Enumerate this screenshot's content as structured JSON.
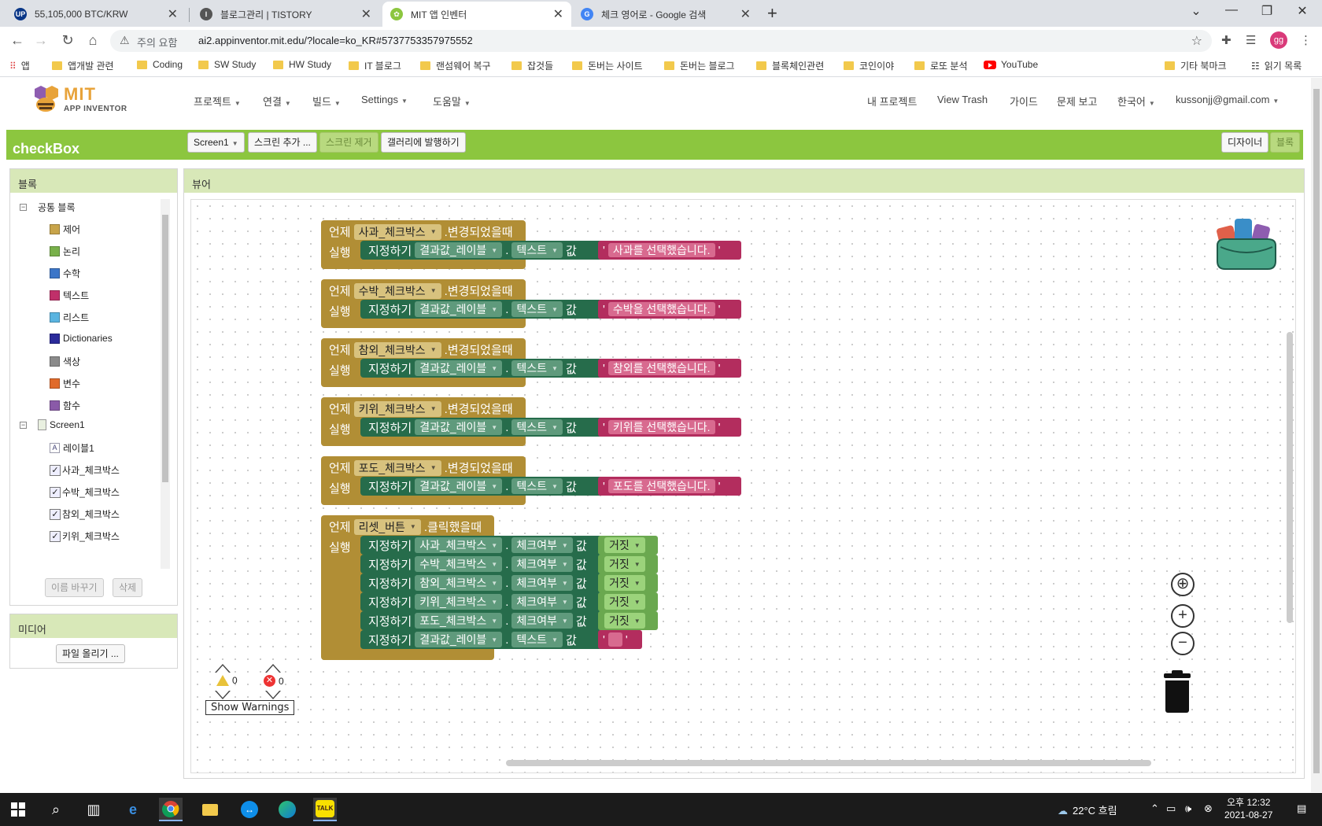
{
  "browser": {
    "tabs": [
      {
        "title": "55,105,000 BTC/KRW",
        "icon": "upbit-icon",
        "color": "#093687",
        "badge": "UP"
      },
      {
        "title": "블로그관리 | TISTORY",
        "icon": "tistory-icon",
        "color": "#333333",
        "badge": "⁝"
      },
      {
        "title": "MIT 앱 인벤터",
        "icon": "mit-app-inventor-icon",
        "color": "#8cc63f",
        "badge": "✿"
      },
      {
        "title": "체크 영어로 - Google 검색",
        "icon": "google-icon",
        "color": "#4285f4",
        "badge": "G"
      }
    ],
    "new_tab": "+",
    "security": "주의 요함",
    "url": "ai2.appinventor.mit.edu/?locale=ko_KR#5737753357975552",
    "profile_initials": "gg",
    "bookmarks": [
      "앱",
      "앱개발 관련",
      "Coding",
      "SW Study",
      "HW Study",
      "IT 블로그",
      "랜섬웨어 복구",
      "잡것들",
      "돈버는 사이트",
      "돈버는 블로그",
      "블록체인관련",
      "코인이야",
      "로또 분석",
      "YouTube"
    ],
    "bookmarks_right": [
      "기타 북마크",
      "읽기 목록"
    ]
  },
  "app_header": {
    "logo_mit": "MIT",
    "logo_sub": "APP INVENTOR",
    "menus": [
      "프로젝트",
      "연결",
      "빌드",
      "Settings",
      "도움말"
    ],
    "right_links": [
      "내 프로젝트",
      "View Trash",
      "가이드",
      "문제 보고",
      "한국어",
      "kussonjj@gmail.com"
    ]
  },
  "toolbar": {
    "project_name": "checkBox",
    "screen_select": "Screen1",
    "add_screen": "스크린 추가 ...",
    "remove_screen": "스크린 제거",
    "publish_gallery": "갤러리에 발행하기",
    "designer": "디자이너",
    "blocks": "블록"
  },
  "blocks_panel": {
    "title": "블록",
    "builtin_root": "공통 블록",
    "builtin": [
      {
        "label": "제어",
        "color": "#c8a44a"
      },
      {
        "label": "논리",
        "color": "#78b04a"
      },
      {
        "label": "수학",
        "color": "#3c76c8"
      },
      {
        "label": "텍스트",
        "color": "#c0306a"
      },
      {
        "label": "리스트",
        "color": "#5ab4e0"
      },
      {
        "label": "Dictionaries",
        "color": "#2a2a9a"
      },
      {
        "label": "색상",
        "color": "#8a8a8a"
      },
      {
        "label": "변수",
        "color": "#e06a2a"
      },
      {
        "label": "함수",
        "color": "#8a5aa8"
      }
    ],
    "screen_root": "Screen1",
    "components": [
      {
        "label": "레이블1",
        "icon": "label-icon",
        "glyph": "A"
      },
      {
        "label": "사과_체크박스",
        "icon": "checkbox-icon",
        "glyph": "✓"
      },
      {
        "label": "수박_체크박스",
        "icon": "checkbox-icon",
        "glyph": "✓"
      },
      {
        "label": "참외_체크박스",
        "icon": "checkbox-icon",
        "glyph": "✓"
      },
      {
        "label": "키위_체크박스",
        "icon": "checkbox-icon",
        "glyph": "✓"
      }
    ],
    "rename": "이름 바꾸기",
    "delete": "삭제"
  },
  "media_panel": {
    "title": "미디어",
    "upload": "파일 올리기 ..."
  },
  "viewer": {
    "title": "뷰어",
    "when": "언제",
    "do": "실행",
    "set": "지정하기",
    "to": "값",
    "changed": ".변경되었을때",
    "clicked": ".클릭했을때",
    "label_component": "결과값_레이블",
    "text_prop": "텍스트",
    "checked_prop": "체크여부",
    "false_value": "거짓",
    "dot": ".",
    "quote": "'",
    "change_events": [
      {
        "component": "사과_체크박스",
        "message": "사과를 선택했습니다."
      },
      {
        "component": "수박_체크박스",
        "message": "수박을 선택했습니다."
      },
      {
        "component": "참외_체크박스",
        "message": "참외를 선택했습니다."
      },
      {
        "component": "키위_체크박스",
        "message": "키위를 선택했습니다."
      },
      {
        "component": "포도_체크박스",
        "message": "포도를 선택했습니다."
      }
    ],
    "reset_event": {
      "component": "리셋_버튼",
      "targets": [
        "사과_체크박스",
        "수박_체크박스",
        "참외_체크박스",
        "키위_체크박스",
        "포도_체크박스"
      ]
    },
    "warnings_count": "0",
    "errors_count": "0",
    "show_warnings": "Show Warnings"
  },
  "taskbar": {
    "weather": "22°C 흐림",
    "time": "오후 12:32",
    "date": "2021-08-27"
  }
}
